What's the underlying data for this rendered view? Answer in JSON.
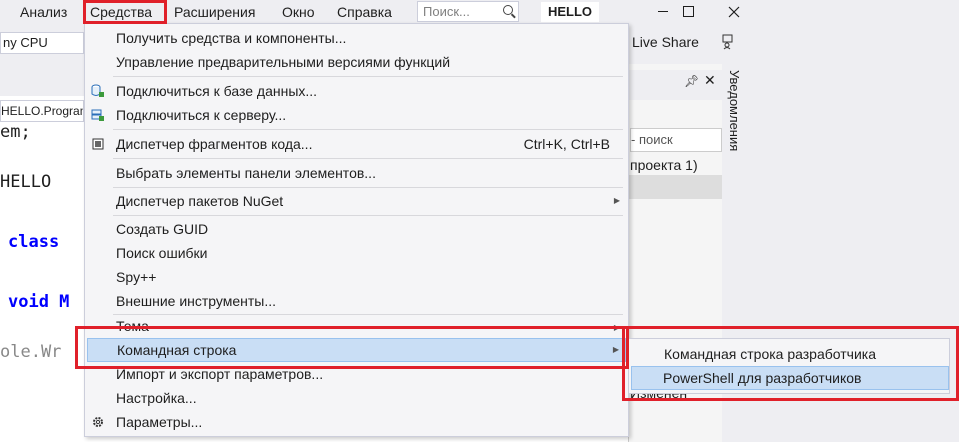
{
  "menubar": {
    "items": [
      "Анализ",
      "Средства",
      "Расширения",
      "Окно",
      "Справка"
    ],
    "search_placeholder": "Поиск...",
    "solution_name": "HELLO"
  },
  "toolbar": {
    "platform": "ny CPU",
    "live_share": "Live Share"
  },
  "editor": {
    "tab": "HELLO.Program",
    "lines": [
      "em;",
      "HELLO",
      "class",
      "void M",
      "ole.Wr"
    ]
  },
  "right_panel": {
    "search_text": "- поиск",
    "project_text": "проекта 1)",
    "bottom_text": "Изменен",
    "notifications": "Уведомления"
  },
  "dropdown": {
    "items": [
      {
        "label": "Получить средства и компоненты...",
        "shortcut": ""
      },
      {
        "label": "Управление предварительными версиями функций",
        "shortcut": ""
      },
      {
        "label": "Подключиться к базе данных...",
        "shortcut": "",
        "icon": "database-icon"
      },
      {
        "label": "Подключиться к серверу...",
        "shortcut": "",
        "icon": "server-icon"
      },
      {
        "label": "Диспетчер фрагментов кода...",
        "shortcut": "Ctrl+K, Ctrl+B",
        "icon": "snippet-icon"
      },
      {
        "label": "Выбрать элементы панели элементов...",
        "shortcut": ""
      },
      {
        "label": "Диспетчер пакетов NuGet",
        "shortcut": "",
        "submenu": true
      },
      {
        "label": "Создать GUID",
        "shortcut": ""
      },
      {
        "label": "Поиск ошибки",
        "shortcut": ""
      },
      {
        "label": "Spy++",
        "shortcut": ""
      },
      {
        "label": "Внешние инструменты...",
        "shortcut": ""
      },
      {
        "label": "Тема",
        "shortcut": "",
        "submenu": true
      },
      {
        "label": "Командная строка",
        "shortcut": "",
        "submenu": true,
        "highlighted": true
      },
      {
        "label": "Импорт и экспорт параметров...",
        "shortcut": ""
      },
      {
        "label": "Настройка...",
        "shortcut": ""
      },
      {
        "label": "Параметры...",
        "shortcut": "",
        "icon": "gear-icon"
      }
    ]
  },
  "submenu": {
    "items": [
      {
        "label": "Командная строка разработчика"
      },
      {
        "label": "PowerShell для разработчиков",
        "highlighted": true
      }
    ]
  },
  "colors": {
    "accent_red": "#e0202a",
    "highlight": "#c9def5",
    "menu_bg": "#f5f5f7",
    "chrome_bg": "#eeeef2",
    "keyword_blue": "#0000ff"
  }
}
